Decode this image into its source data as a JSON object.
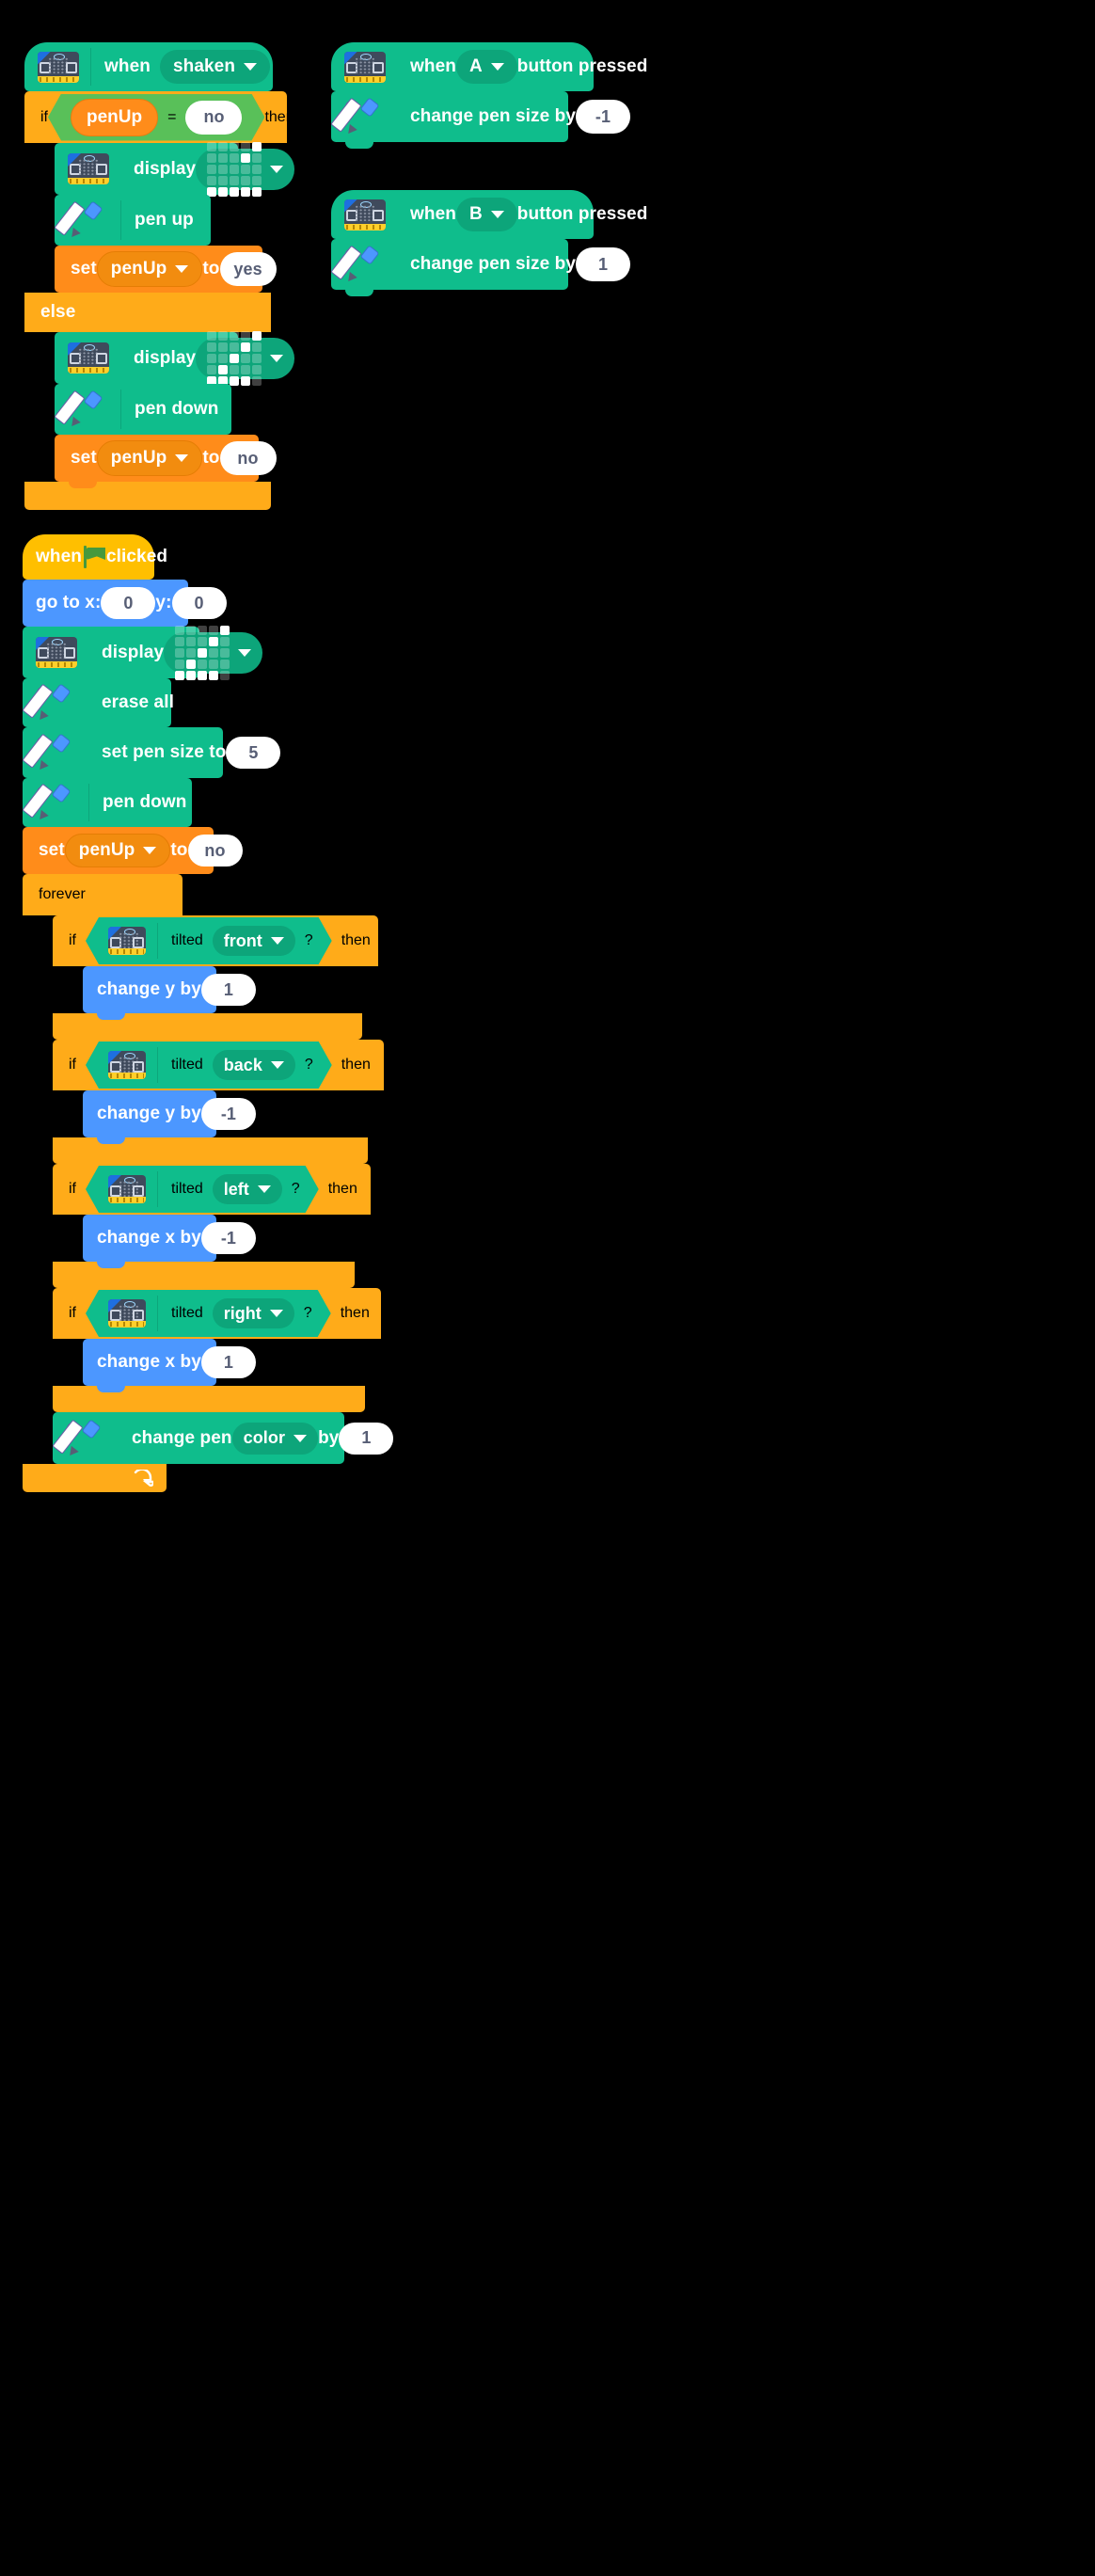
{
  "canvas": {
    "background": "#000000"
  },
  "palette": {
    "microbit": "#0fbd8c",
    "microbit_dark": "#0da57a",
    "control": "#ffab19",
    "data": "#ff8c1a",
    "motion": "#4c97ff",
    "operator": "#59c059",
    "events": "#ffbf00",
    "input_white": "#ffffff",
    "input_text": "#575e75"
  },
  "scripts": [
    {
      "id": "shaken-script",
      "hat": {
        "when": "when",
        "event": "shaken",
        "icon": "microbit-icon"
      },
      "if_label": "if",
      "then_label": "then",
      "else_label": "else",
      "condition": {
        "variable": "penUp",
        "operator": "=",
        "value": "no"
      },
      "then_blocks": [
        {
          "type": "display",
          "label": "display",
          "icon": "microbit-icon",
          "pattern": "arrow-up-right"
        },
        {
          "type": "pen",
          "label": "pen up",
          "icon": "pen-icon"
        },
        {
          "type": "set",
          "set_label": "set",
          "variable": "penUp",
          "to_label": "to",
          "value": "yes"
        }
      ],
      "else_blocks": [
        {
          "type": "display",
          "label": "display",
          "icon": "microbit-icon",
          "pattern": "arrow-down-left"
        },
        {
          "type": "pen",
          "label": "pen down",
          "icon": "pen-icon"
        },
        {
          "type": "set",
          "set_label": "set",
          "variable": "penUp",
          "to_label": "to",
          "value": "no"
        }
      ]
    },
    {
      "id": "button-a-script",
      "hat": {
        "when": "when",
        "button": "A",
        "suffix": "button pressed",
        "icon": "microbit-icon"
      },
      "body": [
        {
          "label": "change pen size by",
          "value": "-1",
          "icon": "pen-icon"
        }
      ]
    },
    {
      "id": "button-b-script",
      "hat": {
        "when": "when",
        "button": "B",
        "suffix": "button pressed",
        "icon": "microbit-icon"
      },
      "body": [
        {
          "label": "change pen size by",
          "value": "1",
          "icon": "pen-icon"
        }
      ]
    },
    {
      "id": "flag-script",
      "hat": {
        "when": "when",
        "flag": "green-flag-icon",
        "clicked": "clicked"
      },
      "body": [
        {
          "type": "motion",
          "label_x": "go to x:",
          "x": "0",
          "label_y": "y:",
          "y": "0"
        },
        {
          "type": "display",
          "label": "display",
          "icon": "microbit-icon",
          "pattern": "arrow-down-left"
        },
        {
          "type": "pen",
          "label": "erase all",
          "icon": "pen-icon"
        },
        {
          "type": "pen_value",
          "label": "set pen size to",
          "value": "5",
          "icon": "pen-icon"
        },
        {
          "type": "pen",
          "label": "pen down",
          "icon": "pen-icon"
        },
        {
          "type": "set",
          "set_label": "set",
          "variable": "penUp",
          "to_label": "to",
          "value": "no"
        }
      ],
      "forever": {
        "label": "forever",
        "ifs": [
          {
            "if_label": "if",
            "then_label": "then",
            "tilted_label": "tilted",
            "direction": "front",
            "qmark": "?",
            "body": {
              "label": "change y by",
              "value": "1"
            }
          },
          {
            "if_label": "if",
            "then_label": "then",
            "tilted_label": "tilted",
            "direction": "back",
            "qmark": "?",
            "body": {
              "label": "change y by",
              "value": "-1"
            }
          },
          {
            "if_label": "if",
            "then_label": "then",
            "tilted_label": "tilted",
            "direction": "left",
            "qmark": "?",
            "body": {
              "label": "change x by",
              "value": "-1"
            }
          },
          {
            "if_label": "if",
            "then_label": "then",
            "tilted_label": "tilted",
            "direction": "right",
            "qmark": "?",
            "body": {
              "label": "change x by",
              "value": "1"
            }
          }
        ],
        "tail": {
          "label_a": "change pen",
          "param": "color",
          "label_b": "by",
          "value": "1",
          "icon": "pen-icon"
        }
      }
    }
  ],
  "matrix_patterns": {
    "arrow-up-right": [
      [
        0,
        0,
        0,
        0,
        1
      ],
      [
        0,
        0,
        0,
        1,
        0
      ],
      [
        0,
        0,
        0,
        0,
        0
      ],
      [
        0,
        0,
        0,
        0,
        0
      ],
      [
        1,
        1,
        1,
        1,
        1
      ]
    ],
    "arrow-down-left": [
      [
        0,
        0,
        0,
        0,
        1
      ],
      [
        0,
        0,
        0,
        1,
        0
      ],
      [
        0,
        0,
        1,
        0,
        0
      ],
      [
        0,
        1,
        0,
        0,
        0
      ],
      [
        1,
        1,
        1,
        1,
        0
      ]
    ]
  }
}
